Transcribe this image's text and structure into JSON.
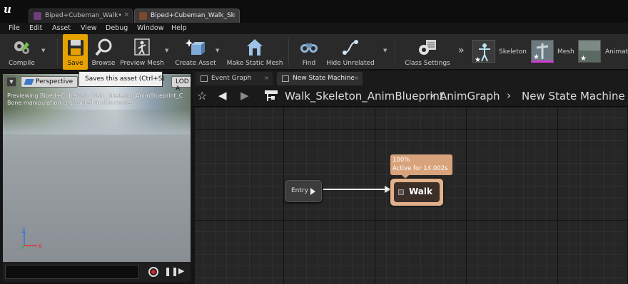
{
  "window": {
    "tabs": [
      {
        "label": "Biped+Cubeman_Walk•",
        "active": false
      },
      {
        "label": "Biped+Cubeman_Walk_Sk",
        "active": true
      }
    ]
  },
  "menu": [
    "File",
    "Edit",
    "Asset",
    "View",
    "Debug",
    "Window",
    "Help"
  ],
  "toolbar": {
    "compile": "Compile",
    "save": "Save",
    "browse": "Browse",
    "preview_mesh": "Preview Mesh",
    "create_asset": "Create Asset",
    "make_static_mesh": "Make Static Mesh",
    "find": "Find",
    "hide_unrelated": "Hide Unrelated",
    "class_settings": "Class Settings",
    "overflow": "»",
    "modes": {
      "skeleton": "Skeleton",
      "mesh": "Mesh",
      "animation": "Animat"
    }
  },
  "tooltip": "Saves this asset (Ctrl+S)",
  "viewport": {
    "perspective": "Perspective",
    "lod": "LOD A",
    "info_line1": "Previewing Biped+Cubeman_Walk_Skeleton_AnimBlueprint_C",
    "info_line2": "Bone manipulation is disabled in this mode.",
    "axis_z": "Z",
    "axis_x": "X"
  },
  "graph_tabs": [
    {
      "label": "Event Graph"
    },
    {
      "label": "New State Machine"
    }
  ],
  "breadcrumb": {
    "asset": "Walk_Skeleton_AnimBlueprint",
    "graph": "AnimGraph",
    "state_machine": "New State Machine"
  },
  "graph": {
    "entry_label": "Entry",
    "state_name": "Walk",
    "state_weight": "100%",
    "state_active": "Active for 14.002s"
  },
  "colors": {
    "save_accent": "#e6a200",
    "state_node": "#e2b08a",
    "record": "#e02020"
  }
}
